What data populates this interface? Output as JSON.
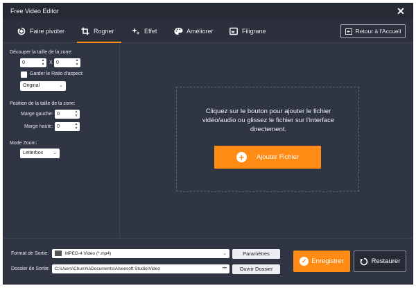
{
  "window": {
    "title": "Free Video Editor"
  },
  "tabs": [
    {
      "label": "Faire pivoter",
      "icon": "rotate-icon"
    },
    {
      "label": "Rogner",
      "icon": "crop-icon"
    },
    {
      "label": "Effet",
      "icon": "sparkle-icon"
    },
    {
      "label": "Améliorer",
      "icon": "palette-icon"
    },
    {
      "label": "Filigrane",
      "icon": "watermark-icon"
    }
  ],
  "active_tab": "Rogner",
  "back_button": {
    "label": "Retour à l'Accueil",
    "icon": "back-arrow-icon"
  },
  "crop": {
    "zone_size_label": "Découper la taille de la zone:",
    "width_value": "0",
    "height_value": "0",
    "separator": "X",
    "keep_ratio_label": "Garder le Ratio d'aspect:",
    "ratio_select": "Original",
    "position_label": "Position de la taille de la zone:",
    "margin_left_label": "Marge gauche:",
    "margin_left_value": "0",
    "margin_top_label": "Marge haute:",
    "margin_top_value": "0",
    "zoom_label": "Mode Zoom:",
    "zoom_select": "Letterbox"
  },
  "dropzone": {
    "text": "Cliquez sur le bouton pour ajouter le fichier vidéo/audio ou glissez le fichier sur l'interface directement.",
    "add_button": "Ajouter Fichier"
  },
  "output": {
    "format_label": "Format de Sortie:",
    "format_value": "MPEG-4 Video (*.mp4)",
    "settings_button": "Paramètres",
    "folder_label": "Dossier de Sortie:",
    "folder_value": "C:\\Users\\ChunYu\\Documents\\Aiseesoft Studio\\Video",
    "browse_dots": "•••",
    "open_folder_button": "Ouvrir Dossier",
    "save_button": "Enregistrer",
    "restore_button": "Restaurer"
  },
  "colors": {
    "accent": "#ff8a14",
    "background": "#2f3543",
    "titlebar": "#252a35"
  }
}
